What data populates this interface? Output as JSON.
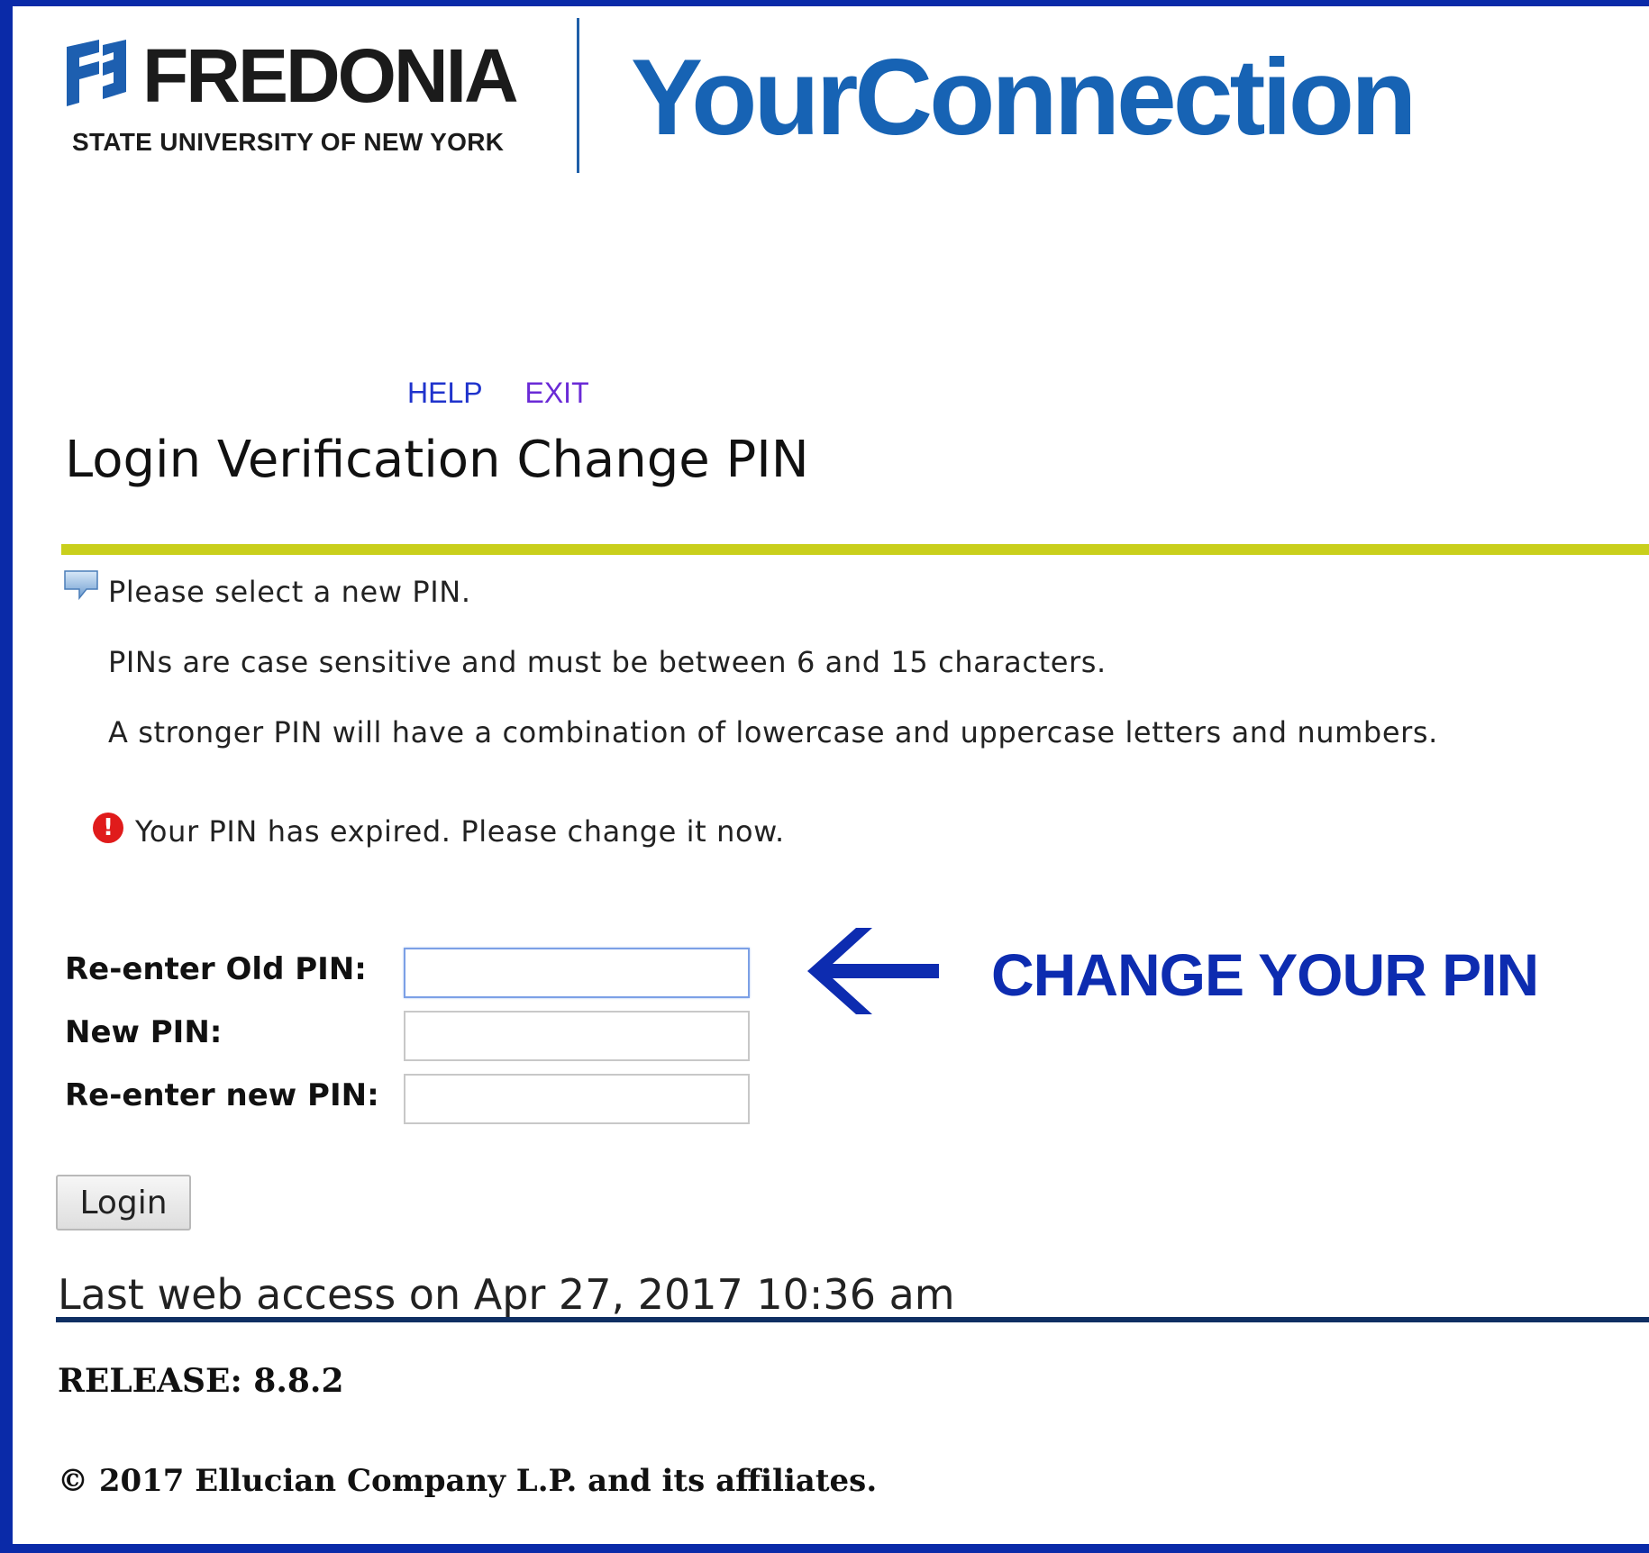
{
  "header": {
    "logo_name": "FREDONIA",
    "logo_subtitle": "STATE UNIVERSITY OF NEW YORK",
    "app_title": "YourConnection"
  },
  "nav": {
    "help_label": "HELP",
    "exit_label": "EXIT"
  },
  "page_title": "Login Verification Change PIN",
  "info": {
    "select_text": "Please select a new PIN.",
    "rules_text": "PINs are case sensitive and must be between 6 and 15 characters.",
    "strength_text": "A stronger PIN will have a combination of lowercase and uppercase letters and numbers."
  },
  "error": {
    "icon_glyph": "!",
    "message": "Your PIN has expired. Please change it now."
  },
  "form": {
    "old_pin_label": "Re-enter Old PIN:",
    "new_pin_label": "New PIN:",
    "confirm_pin_label": "Re-enter new PIN:",
    "old_pin_value": "",
    "new_pin_value": "",
    "confirm_pin_value": "",
    "submit_label": "Login"
  },
  "callout": {
    "text": "CHANGE YOUR PIN",
    "arrow_icon": "left-arrow-icon"
  },
  "footer": {
    "last_access": "Last web access on Apr 27, 2017 10:36 am",
    "release": "RELEASE: 8.8.2",
    "copyright": "© 2017 Ellucian Company L.P. and its affiliates."
  },
  "colors": {
    "frame": "#0a2aa8",
    "brand_blue": "#1763b4",
    "accent_rule": "#c9cf1c",
    "footer_rule": "#0f2f63",
    "callout": "#0d2cb0",
    "error": "#e01b1b"
  }
}
